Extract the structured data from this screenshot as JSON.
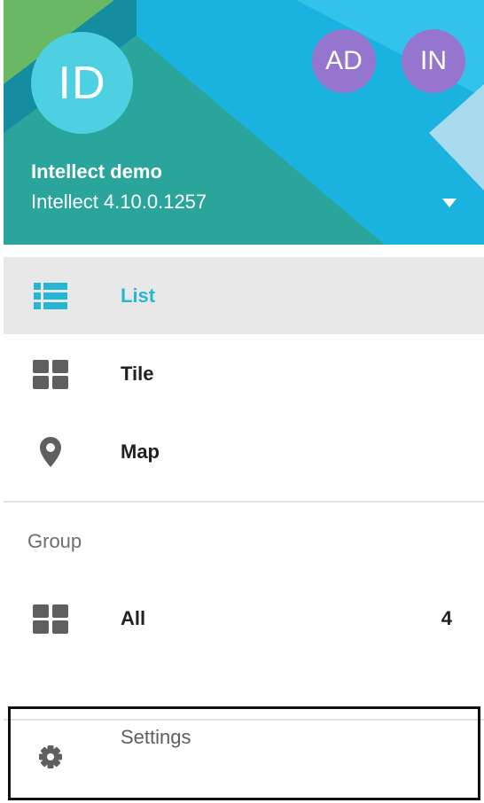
{
  "header": {
    "account_avatar_initials": "ID",
    "other_accounts": [
      {
        "initials": "AD",
        "color": "#9575cd"
      },
      {
        "initials": "IN",
        "color": "#9575cd"
      }
    ],
    "account_name": "Intellect demo",
    "account_version": "Intellect 4.10.0.1257",
    "colors": {
      "primary": "#0b8fbe",
      "accent": "#4dd0e1"
    }
  },
  "menu": {
    "items": [
      {
        "label": "List",
        "icon": "list-icon",
        "active": true
      },
      {
        "label": "Tile",
        "icon": "tile-grid-icon",
        "active": false
      },
      {
        "label": "Map",
        "icon": "map-pin-icon",
        "active": false
      }
    ]
  },
  "group": {
    "header": "Group",
    "items": [
      {
        "label": "All",
        "icon": "tile-grid-icon",
        "count": "4"
      }
    ]
  },
  "settings": {
    "label": "Settings",
    "icon": "gear-icon"
  },
  "colors": {
    "active_text": "#26b6d3",
    "active_bg": "#e8e8e8",
    "icon_gray": "#5f5f5f"
  }
}
